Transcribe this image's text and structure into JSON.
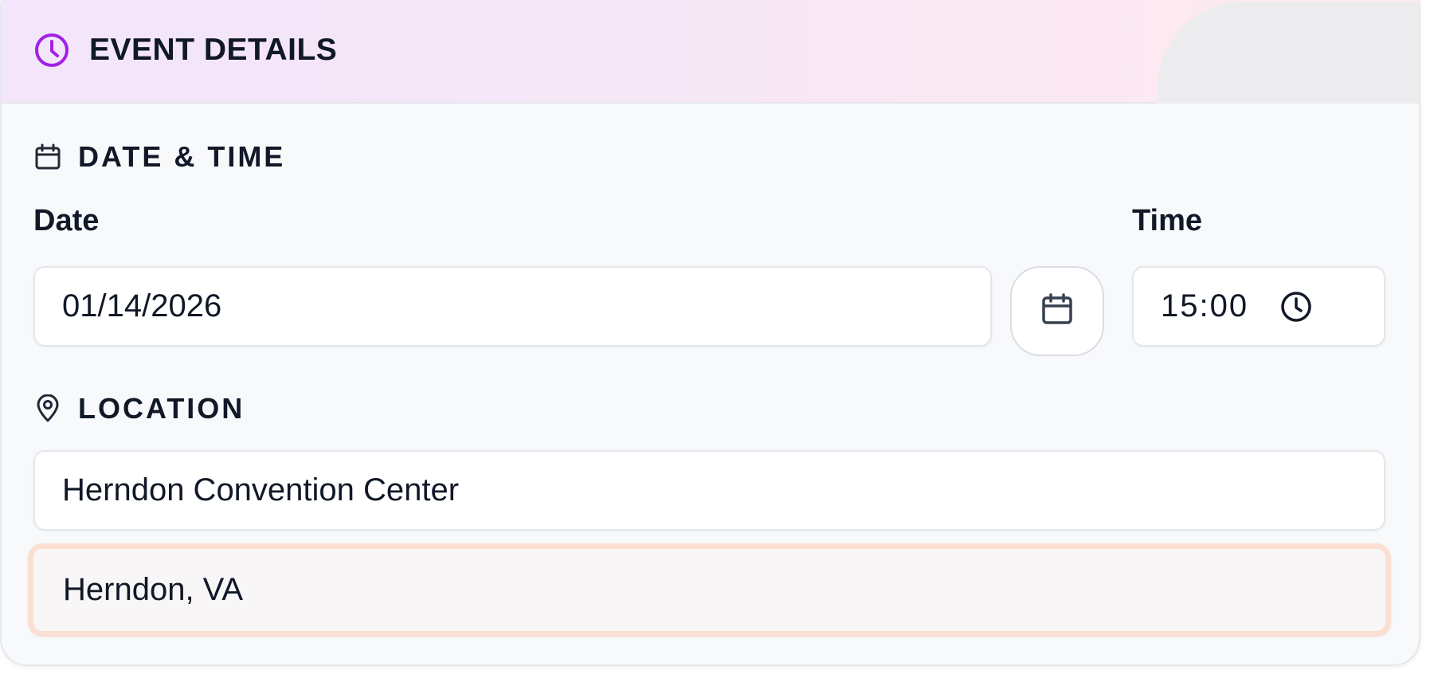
{
  "header": {
    "title": "EVENT DETAILS",
    "icon": "clock-icon",
    "accent_color": "#9333ea"
  },
  "date_time_section": {
    "title": "DATE & TIME",
    "icon": "calendar-icon",
    "date_label": "Date",
    "date_value": "01/14/2026",
    "calendar_button_icon": "calendar-icon",
    "time_label": "Time",
    "time_value": "15:00",
    "time_icon": "clock-icon"
  },
  "location_section": {
    "title": "LOCATION",
    "icon": "map-pin-icon",
    "venue_value": "Herndon Convention Center",
    "city_value": "Herndon, VA"
  },
  "colors": {
    "text": "#111827",
    "highlight_border": "#fbdfd2"
  }
}
